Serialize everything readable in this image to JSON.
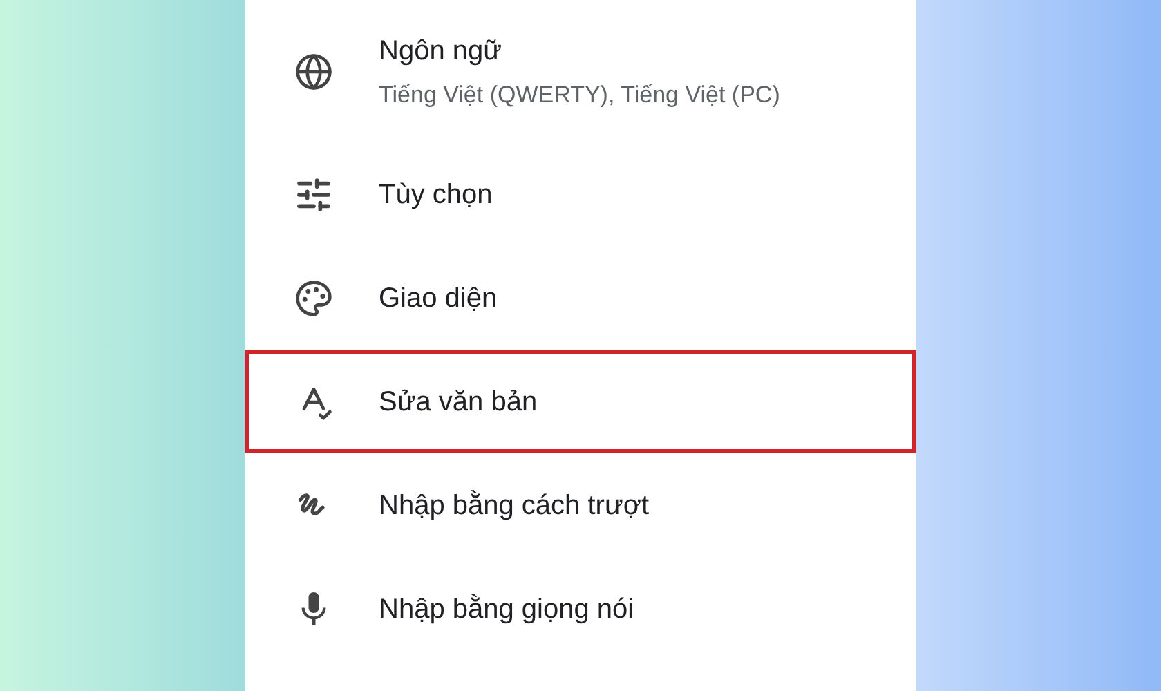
{
  "settings_items": [
    {
      "title": "Ngôn ngữ",
      "subtitle": "Tiếng Việt (QWERTY), Tiếng Việt (PC)",
      "highlighted": false
    },
    {
      "title": "Tùy chọn",
      "highlighted": false
    },
    {
      "title": "Giao diện",
      "highlighted": false
    },
    {
      "title": "Sửa văn bản",
      "highlighted": true
    },
    {
      "title": "Nhập bằng cách trượt",
      "highlighted": false
    },
    {
      "title": "Nhập bằng giọng nói",
      "highlighted": false
    }
  ]
}
